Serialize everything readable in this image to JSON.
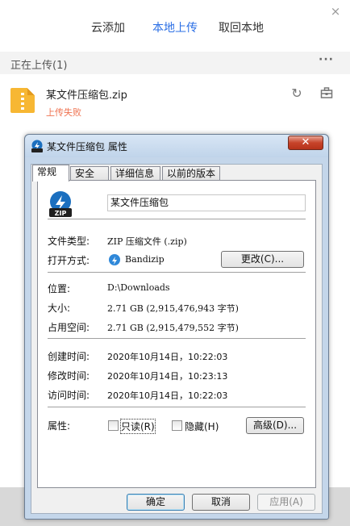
{
  "panel": {
    "tabs": [
      {
        "label": "云添加"
      },
      {
        "label": "本地上传"
      },
      {
        "label": "取回本地"
      }
    ],
    "close_glyph": "×",
    "section_title": "正在上传(1)",
    "more_glyph": "···",
    "file": {
      "name": "某文件压缩包.zip",
      "status": "上传失败",
      "retry_glyph": "↻",
      "icon": "zip-file-icon"
    },
    "colors": {
      "active_tab": "#2b6fe5",
      "status_error": "#ef7250",
      "zip_icon": "#f7b733"
    }
  },
  "dialog": {
    "title": "某文件压缩包 属性",
    "close_glyph": "✕",
    "tabs": [
      {
        "label": "常规"
      },
      {
        "label": "安全"
      },
      {
        "label": "详细信息"
      },
      {
        "label": "以前的版本"
      }
    ],
    "file_name": "某文件压缩包",
    "rows": {
      "type_label": "文件类型:",
      "type_value": "ZIP 压缩文件 (.zip)",
      "open_label": "打开方式:",
      "open_value": "Bandizip",
      "change_button": "更改(C)...",
      "location_label": "位置:",
      "location_value": "D:\\Downloads",
      "size_label": "大小:",
      "size_value": "2.71 GB (2,915,476,943 字节)",
      "disk_label": "占用空间:",
      "disk_value": "2.71 GB (2,915,479,552 字节)",
      "created_label": "创建时间:",
      "created_value": "2020年10月14日，10:22:03",
      "modified_label": "修改时间:",
      "modified_value": "2020年10月14日，10:23:13",
      "accessed_label": "访问时间:",
      "accessed_value": "2020年10月14日，10:22:03",
      "attr_label": "属性:",
      "readonly_label": "只读(R)",
      "hidden_label": "隐藏(H)",
      "advanced_button": "高级(D)..."
    },
    "buttons": {
      "ok": "确定",
      "cancel": "取消",
      "apply": "应用(A)"
    }
  }
}
